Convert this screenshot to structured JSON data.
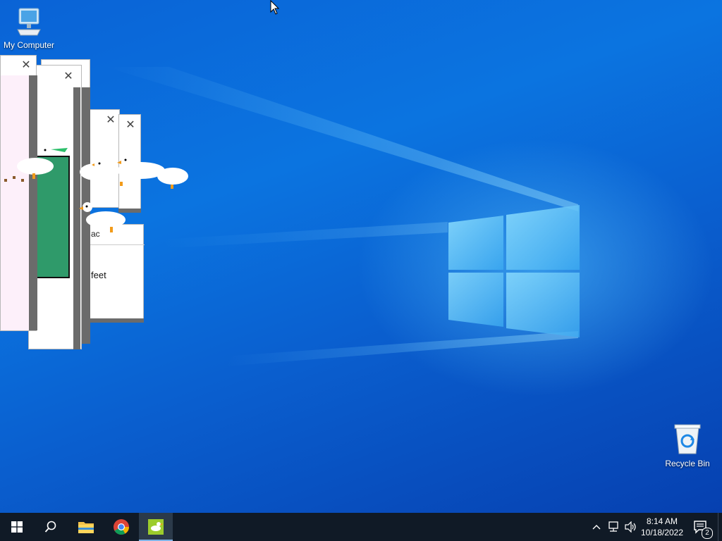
{
  "desktop": {
    "icons": [
      {
        "label": "My Computer"
      },
      {
        "label": "Recycle Bin"
      }
    ]
  },
  "windows": {
    "partial_text": "feet",
    "partial_title": "ac"
  },
  "taskbar": {
    "items": [
      {
        "name": "start-button",
        "icon": "windows-logo"
      },
      {
        "name": "search",
        "icon": "search-icon"
      },
      {
        "name": "file-explorer",
        "icon": "folder-icon"
      },
      {
        "name": "chrome",
        "icon": "chrome-icon"
      },
      {
        "name": "goose-app",
        "icon": "goose-app-icon",
        "active": true
      }
    ],
    "clock": {
      "time": "8:14 AM",
      "date": "10/18/2022"
    },
    "notification_count": "2"
  },
  "colors": {
    "desktop_bg": "#0a63d6",
    "taskbar_bg": "#101a26",
    "window_green": "#2f9a6a",
    "window_pink": "#fdf0fa"
  }
}
